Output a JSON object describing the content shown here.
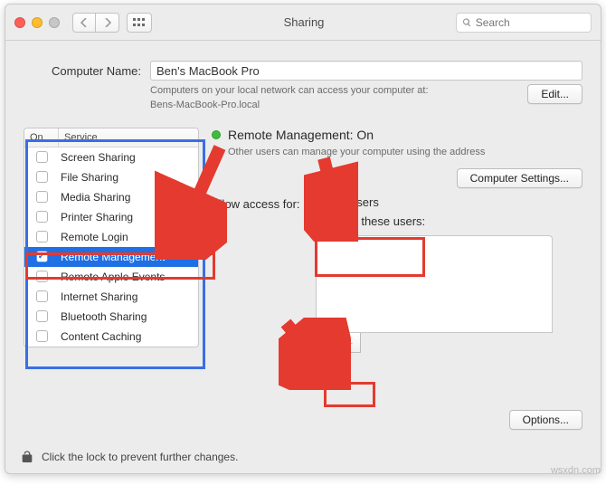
{
  "window": {
    "title": "Sharing"
  },
  "search": {
    "placeholder": "Search"
  },
  "computer_name": {
    "label": "Computer Name:",
    "value": "Ben's MacBook Pro",
    "info_line1": "Computers on your local network can access your computer at:",
    "info_hostname": "Bens-MacBook-Pro.local",
    "edit_label": "Edit..."
  },
  "services": {
    "header_on": "On",
    "header_service": "Service",
    "items": [
      {
        "label": "Screen Sharing"
      },
      {
        "label": "File Sharing"
      },
      {
        "label": "Media Sharing"
      },
      {
        "label": "Printer Sharing"
      },
      {
        "label": "Remote Login"
      },
      {
        "label": "Remote Management"
      },
      {
        "label": "Remote Apple Events"
      },
      {
        "label": "Internet Sharing"
      },
      {
        "label": "Bluetooth Sharing"
      },
      {
        "label": "Content Caching"
      }
    ],
    "selected_index": 5
  },
  "status": {
    "title": "Remote Management: On",
    "desc": "Other users can manage your computer using the address"
  },
  "computer_settings_label": "Computer Settings...",
  "access": {
    "label": "Allow access for:",
    "options": [
      {
        "label": "All users"
      },
      {
        "label": "Only these users:"
      }
    ],
    "selected_index": 0
  },
  "options_label": "Options...",
  "lock_hint": "Click the lock to prevent further changes.",
  "watermark": "wsxdn.com"
}
